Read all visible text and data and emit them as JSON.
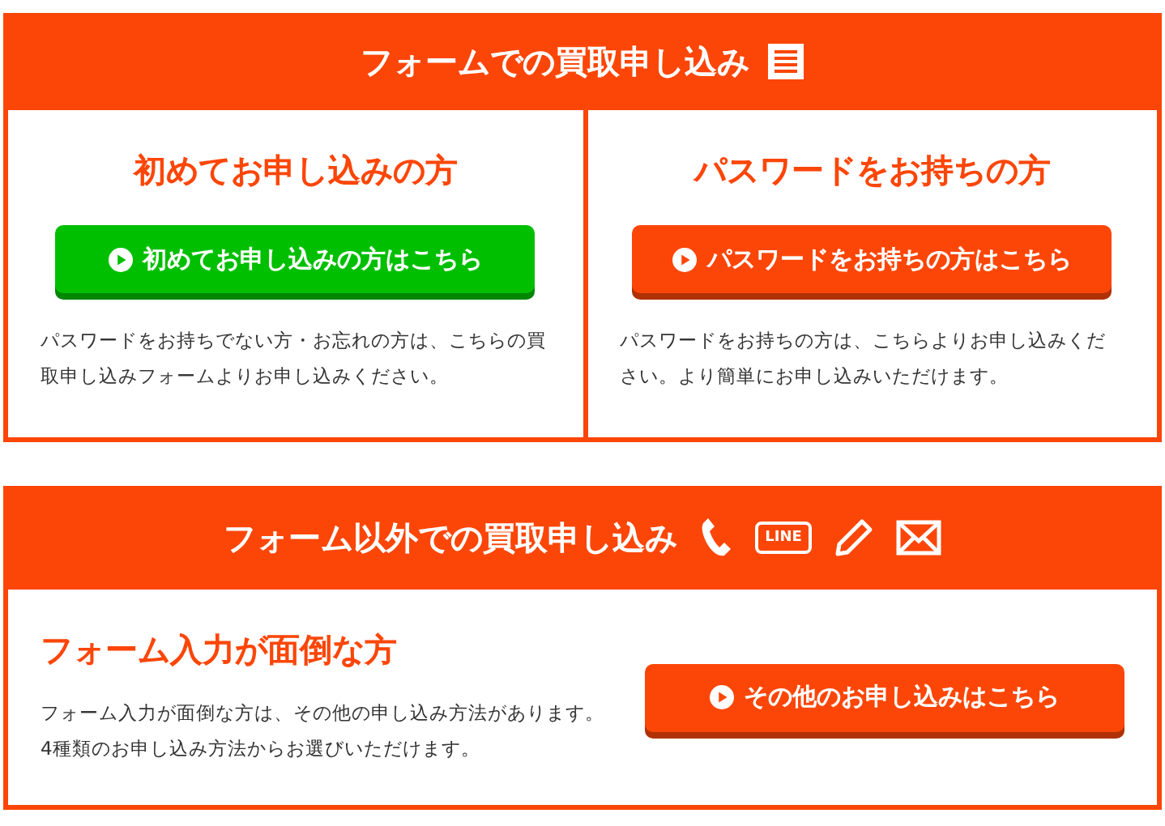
{
  "form_section": {
    "title": "フォームでの買取申し込み",
    "cards": [
      {
        "heading": "初めてお申し込みの方",
        "button": "初めてお申し込みの方はこちら",
        "color": "#00bf00",
        "text": "パスワードをお持ちでない方・お忘れの方は、こちらの買取申し込みフォームよりお申し込みください。"
      },
      {
        "heading": "パスワードをお持ちの方",
        "button": "パスワードをお持ちの方はこちら",
        "color": "#fc4608",
        "text": "パスワードをお持ちの方は、こちらよりお申し込みください。より簡単にお申し込みいただけます。"
      }
    ]
  },
  "other_section": {
    "title": "フォーム以外での買取申し込み",
    "line_badge": "LINE",
    "heading": "フォーム入力が面倒な方",
    "lines": [
      "フォーム入力が面倒な方は、その他の申し込み方法があります。",
      "4種類のお申し込み方法からお選びいただけます。"
    ],
    "button": "その他のお申し込みはこちら",
    "color": "#fc4608"
  }
}
